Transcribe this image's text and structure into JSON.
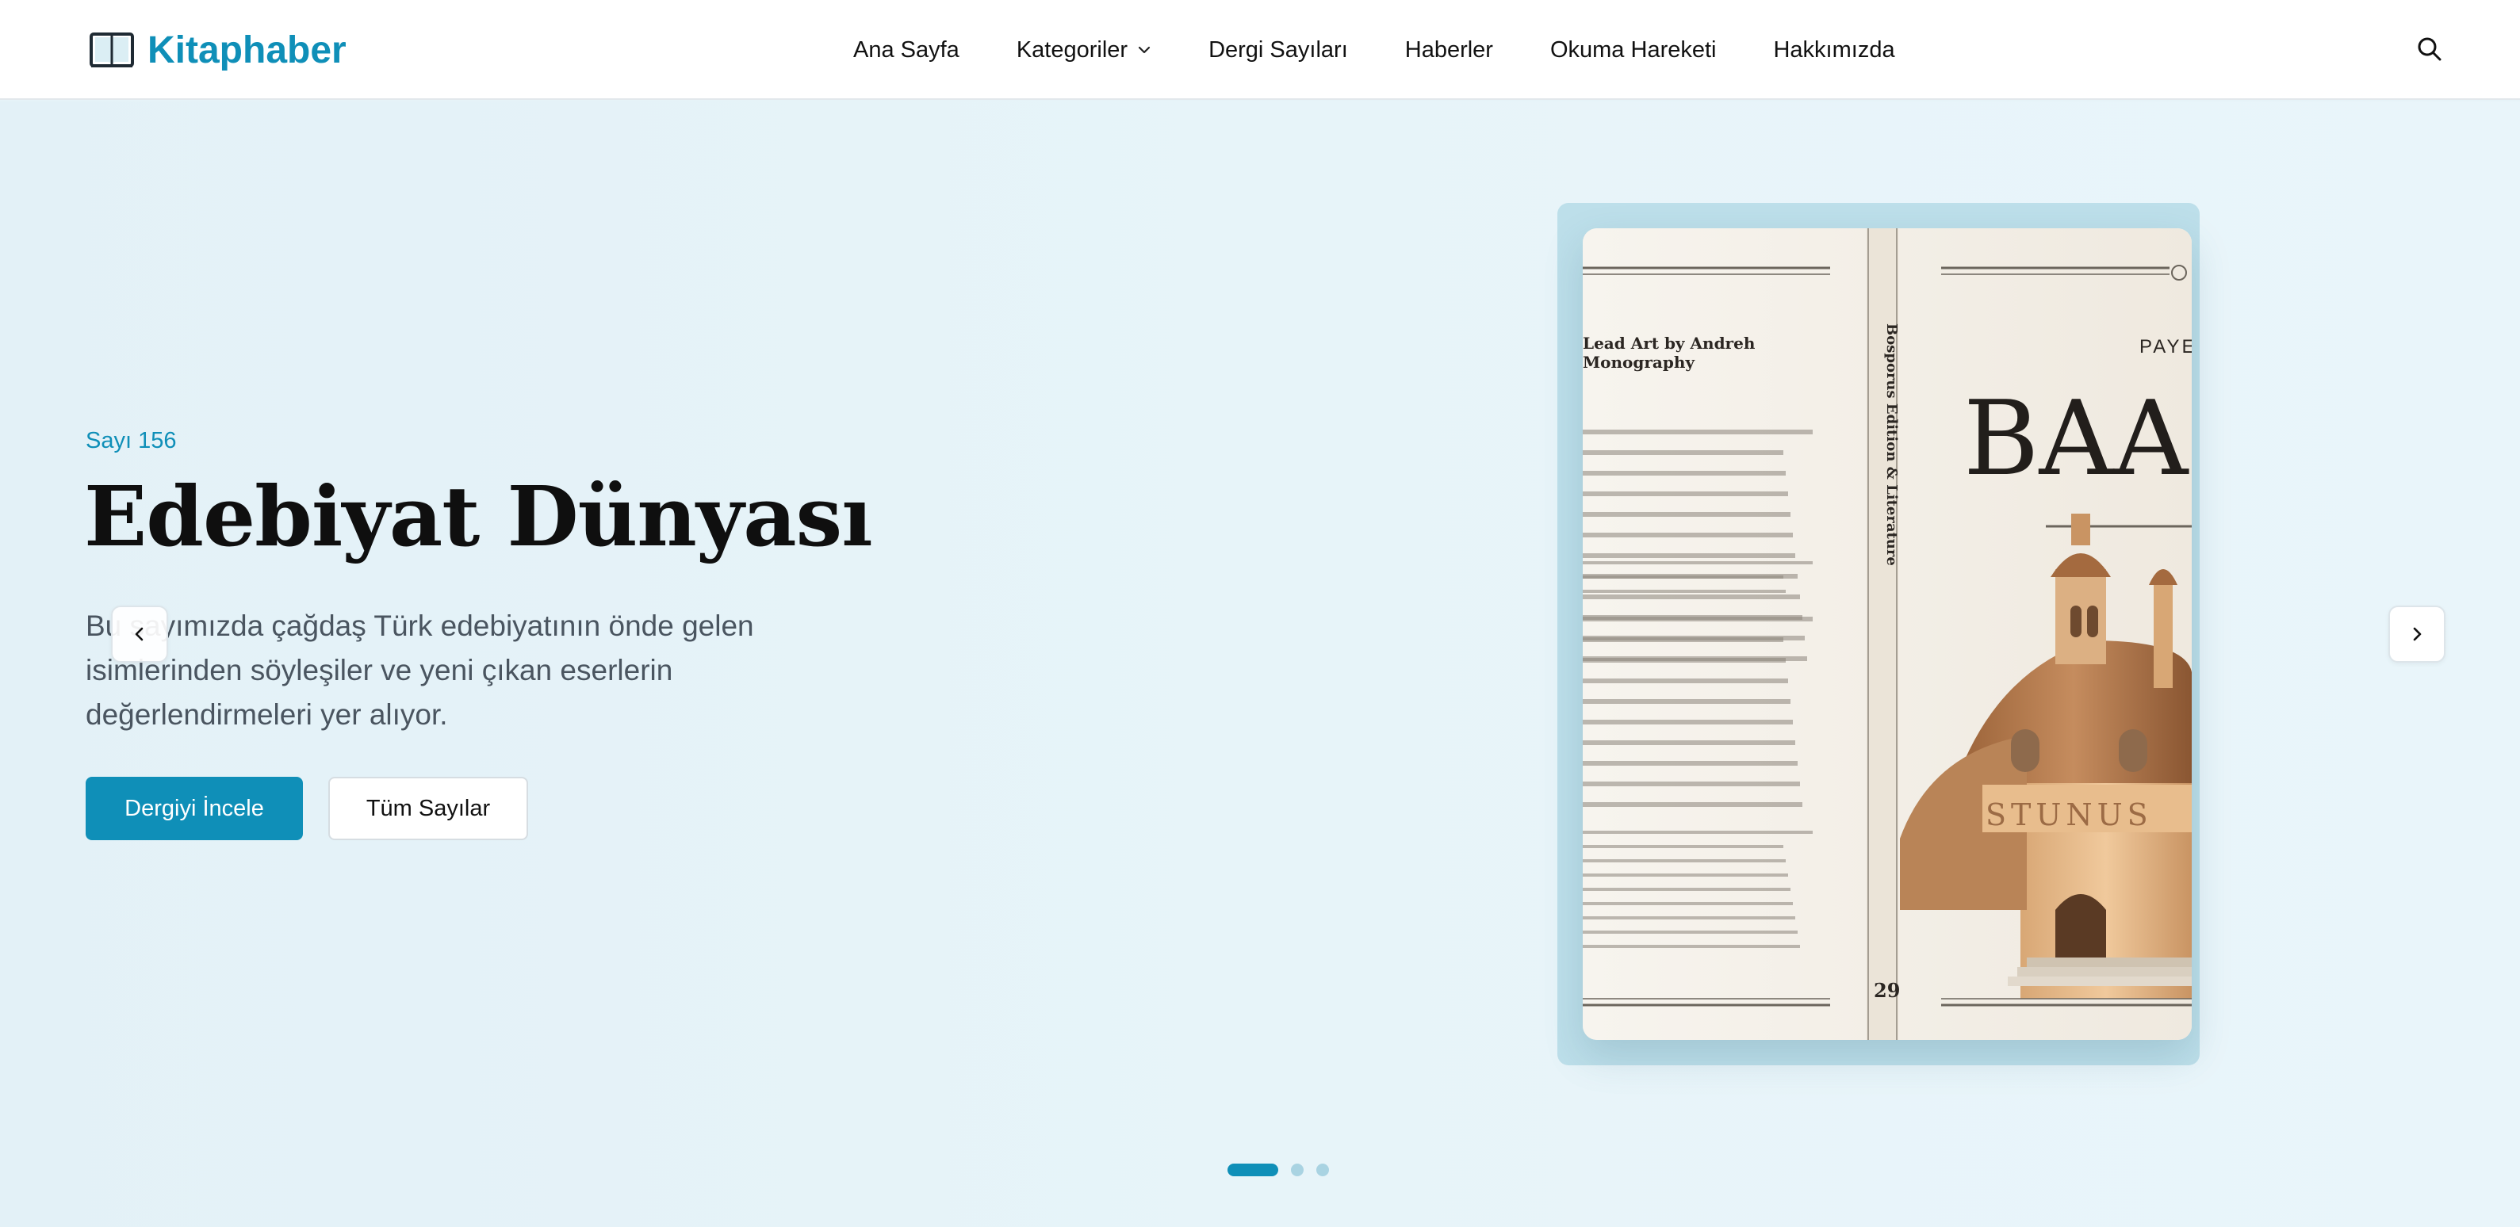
{
  "brand": {
    "name": "Kitaphaber",
    "logo_icon": "open-book-icon",
    "color": "#0f8fb8"
  },
  "nav": {
    "items": [
      {
        "label": "Ana Sayfa"
      },
      {
        "label": "Kategoriler",
        "has_dropdown": true
      },
      {
        "label": "Dergi Sayıları"
      },
      {
        "label": "Haberler"
      },
      {
        "label": "Okuma Hareketi"
      },
      {
        "label": "Hakkımızda"
      }
    ],
    "search_icon": "search-icon"
  },
  "hero": {
    "issue_label": "Sayı 156",
    "title": "Edebiyat Dünyası",
    "description": "Bu sayımızda çağdaş Türk edebiyatının önde gelen isimlerinden söyleşiler ve yeni çıkan eserlerin değerlendirmeleri yer alıyor.",
    "primary_button": "Dergiyi İncele",
    "secondary_button": "Tüm Sayılar"
  },
  "magazine": {
    "spine_text": "Bosporus Edition & Literature",
    "page_number": "29",
    "cover_prefix": "PAYE",
    "cover_title": "BAAZ",
    "building_inscription": "STUNUS",
    "left_heading_1": "Lead Art by Andreh",
    "left_heading_2": "Monography"
  },
  "carousel": {
    "slide_count": 3,
    "active_index": 0
  },
  "colors": {
    "accent": "#0f8fb8",
    "hero_bg": "#e6f3f8",
    "text_muted": "#4a5560"
  }
}
